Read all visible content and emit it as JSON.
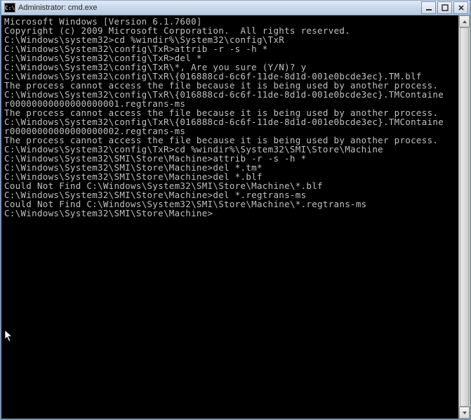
{
  "window": {
    "icon_text": "C:\\",
    "title": "Administrator: cmd.exe"
  },
  "controls": {
    "minimize": "minimize-button",
    "maximize": "maximize-button",
    "close": "close-button"
  },
  "cursor_glyph": "▲",
  "terminal_lines": [
    "Microsoft Windows [Version 6.1.7600]",
    "Copyright (c) 2009 Microsoft Corporation.  All rights reserved.",
    "",
    "C:\\Windows\\system32>cd %windir%\\System32\\config\\TxR",
    "",
    "C:\\Windows\\System32\\config\\TxR>attrib -r -s -h *",
    "",
    "C:\\Windows\\System32\\config\\TxR>del *",
    "C:\\Windows\\System32\\config\\TxR\\*, Are you sure (Y/N)? y",
    "C:\\Windows\\System32\\config\\TxR\\{016888cd-6c6f-11de-8d1d-001e0bcde3ec}.TM.blf",
    "The process cannot access the file because it is being used by another process.",
    "C:\\Windows\\System32\\config\\TxR\\{016888cd-6c6f-11de-8d1d-001e0bcde3ec}.TMContaine",
    "r00000000000000000001.regtrans-ms",
    "The process cannot access the file because it is being used by another process.",
    "C:\\Windows\\System32\\config\\TxR\\{016888cd-6c6f-11de-8d1d-001e0bcde3ec}.TMContaine",
    "r00000000000000000002.regtrans-ms",
    "The process cannot access the file because it is being used by another process.",
    "",
    "C:\\Windows\\System32\\config\\TxR>cd %windir%\\System32\\SMI\\Store\\Machine",
    "",
    "C:\\Windows\\System32\\SMI\\Store\\Machine>attrib -r -s -h *",
    "",
    "C:\\Windows\\System32\\SMI\\Store\\Machine>del *.tm*",
    "",
    "C:\\Windows\\System32\\SMI\\Store\\Machine>del *.blf",
    "Could Not Find C:\\Windows\\System32\\SMI\\Store\\Machine\\*.blf",
    "",
    "C:\\Windows\\System32\\SMI\\Store\\Machine>del *.regtrans-ms",
    "Could Not Find C:\\Windows\\System32\\SMI\\Store\\Machine\\*.regtrans-ms",
    "",
    "C:\\Windows\\System32\\SMI\\Store\\Machine>"
  ]
}
